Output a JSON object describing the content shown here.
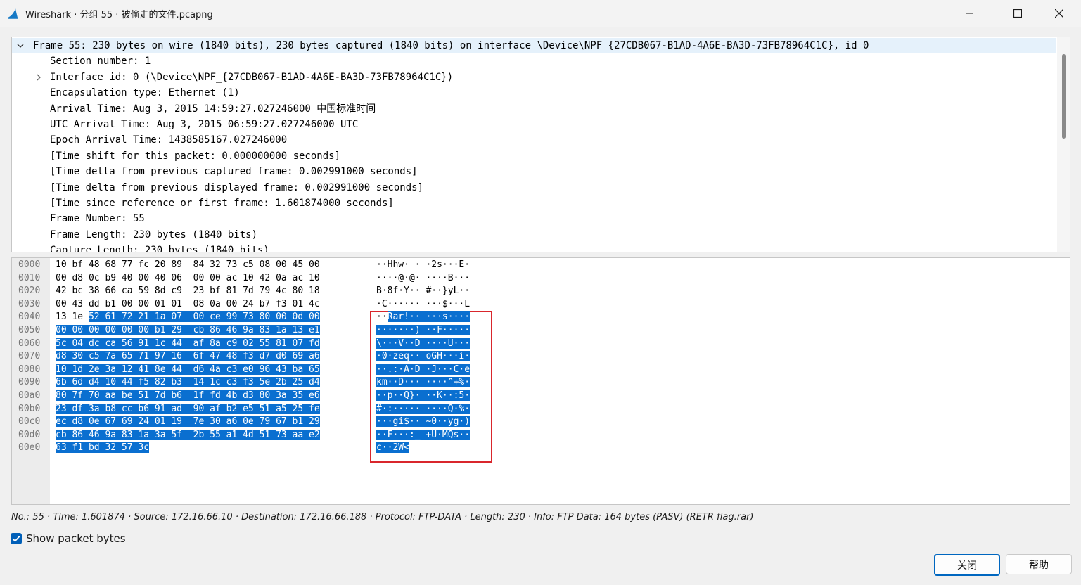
{
  "window": {
    "title": "Wireshark · 分组 55 · 被偷走的文件.pcapng",
    "icon": "wireshark-fin-icon"
  },
  "detail_tree": {
    "rows": [
      {
        "caret": "expanded",
        "indent": 0,
        "text": "Frame 55: 230 bytes on wire (1840 bits), 230 bytes captured (1840 bits) on interface \\Device\\NPF_{27CDB067-B1AD-4A6E-BA3D-73FB78964C1C}, id 0"
      },
      {
        "caret": "none",
        "indent": 1,
        "text": "Section number: 1"
      },
      {
        "caret": "collapsed",
        "indent": 1,
        "text": "Interface id: 0 (\\Device\\NPF_{27CDB067-B1AD-4A6E-BA3D-73FB78964C1C})"
      },
      {
        "caret": "none",
        "indent": 1,
        "text": "Encapsulation type: Ethernet (1)"
      },
      {
        "caret": "none",
        "indent": 1,
        "text": "Arrival Time: Aug  3, 2015 14:59:27.027246000 中国标准时间"
      },
      {
        "caret": "none",
        "indent": 1,
        "text": "UTC Arrival Time: Aug  3, 2015 06:59:27.027246000 UTC"
      },
      {
        "caret": "none",
        "indent": 1,
        "text": "Epoch Arrival Time: 1438585167.027246000"
      },
      {
        "caret": "none",
        "indent": 1,
        "text": "[Time shift for this packet: 0.000000000 seconds]"
      },
      {
        "caret": "none",
        "indent": 1,
        "text": "[Time delta from previous captured frame: 0.002991000 seconds]"
      },
      {
        "caret": "none",
        "indent": 1,
        "text": "[Time delta from previous displayed frame: 0.002991000 seconds]"
      },
      {
        "caret": "none",
        "indent": 1,
        "text": "[Time since reference or first frame: 1.601874000 seconds]"
      },
      {
        "caret": "none",
        "indent": 1,
        "text": "Frame Number: 55"
      },
      {
        "caret": "none",
        "indent": 1,
        "text": "Frame Length: 230 bytes (1840 bits)"
      },
      {
        "caret": "none",
        "indent": 1,
        "text": "Capture Length: 230 bytes (1840 bits)"
      }
    ]
  },
  "hex_dump": {
    "selection_color": "#0a6fd0",
    "annotation_box_color": "#d9262c",
    "rows": [
      {
        "offset": "0000",
        "hex": "10 bf 48 68 77 fc 20 89  84 32 73 c5 08 00 45 00",
        "ascii": "··Hhw· · ·2s···E·",
        "hl_hex_from": null,
        "hl_ascii_from": null
      },
      {
        "offset": "0010",
        "hex": "00 d8 0c b9 40 00 40 06  00 00 ac 10 42 0a ac 10",
        "ascii": "····@·@· ····B···",
        "hl_hex_from": null,
        "hl_ascii_from": null
      },
      {
        "offset": "0020",
        "hex": "42 bc 38 66 ca 59 8d c9  23 bf 81 7d 79 4c 80 18",
        "ascii": "B·8f·Y·· #··}yL··",
        "hl_hex_from": null,
        "hl_ascii_from": null
      },
      {
        "offset": "0030",
        "hex": "00 43 dd b1 00 00 01 01  08 0a 00 24 b7 f3 01 4c",
        "ascii": "·C······ ···$···L",
        "hl_hex_from": null,
        "hl_ascii_from": null
      },
      {
        "offset": "0040",
        "hex": "13 1e 52 61 72 21 1a 07  00 ce 99 73 80 00 0d 00",
        "ascii": "··Rar!·· ···s····",
        "hl_hex_from": 6,
        "hl_ascii_from": 2
      },
      {
        "offset": "0050",
        "hex": "00 00 00 00 00 00 b1 29  cb 86 46 9a 83 1a 13 e1",
        "ascii": "·······) ··F·····",
        "hl_hex_from": 0,
        "hl_ascii_from": 0
      },
      {
        "offset": "0060",
        "hex": "5c 04 dc ca 56 91 1c 44  af 8a c9 02 55 81 07 fd",
        "ascii": "\\···V··D ····U···",
        "hl_hex_from": 0,
        "hl_ascii_from": 0
      },
      {
        "offset": "0070",
        "hex": "d8 30 c5 7a 65 71 97 16  6f 47 48 f3 d7 d0 69 a6",
        "ascii": "·0·zeq·· oGH···i·",
        "hl_hex_from": 0,
        "hl_ascii_from": 0
      },
      {
        "offset": "0080",
        "hex": "10 1d 2e 3a 12 41 8e 44  d6 4a c3 e0 96 43 ba 65",
        "ascii": "··.:·A·D ·J···C·e",
        "hl_hex_from": 0,
        "hl_ascii_from": 0
      },
      {
        "offset": "0090",
        "hex": "6b 6d d4 10 44 f5 82 b3  14 1c c3 f3 5e 2b 25 d4",
        "ascii": "km··D··· ····^+%·",
        "hl_hex_from": 0,
        "hl_ascii_from": 0
      },
      {
        "offset": "00a0",
        "hex": "80 7f 70 aa be 51 7d b6  1f fd 4b d3 80 3a 35 e6",
        "ascii": "··p··Q}· ··K··:5·",
        "hl_hex_from": 0,
        "hl_ascii_from": 0
      },
      {
        "offset": "00b0",
        "hex": "23 df 3a b8 cc b6 91 ad  90 af b2 e5 51 a5 25 fe",
        "ascii": "#·:····· ····Q·%·",
        "hl_hex_from": 0,
        "hl_ascii_from": 0
      },
      {
        "offset": "00c0",
        "hex": "ec d8 0e 67 69 24 01 19  7e 30 a6 0e 79 67 b1 29",
        "ascii": "···gi$·· ~0··yg·)",
        "hl_hex_from": 0,
        "hl_ascii_from": 0
      },
      {
        "offset": "00d0",
        "hex": "cb 86 46 9a 83 1a 3a 5f  2b 55 a1 4d 51 73 aa e2",
        "ascii": "··F···:_ +U·MQs··",
        "hl_hex_from": 0,
        "hl_ascii_from": 0
      },
      {
        "offset": "00e0",
        "hex": "63 f1 bd 32 57 3c",
        "ascii": "c··2W<",
        "hl_hex_from": 0,
        "hl_ascii_from": 0
      }
    ]
  },
  "status_line": "No.: 55 · Time: 1.601874 · Source: 172.16.66.10 · Destination: 172.16.66.188 · Protocol: FTP-DATA · Length: 230 · Info: FTP Data: 164 bytes (PASV) (RETR flag.rar)",
  "show_bytes": {
    "label": "Show packet bytes",
    "checked": true
  },
  "buttons": {
    "close": "关闭",
    "help": "帮助"
  },
  "colors": {
    "accent": "#005fb8",
    "window_bg": "#f0f0f0"
  }
}
